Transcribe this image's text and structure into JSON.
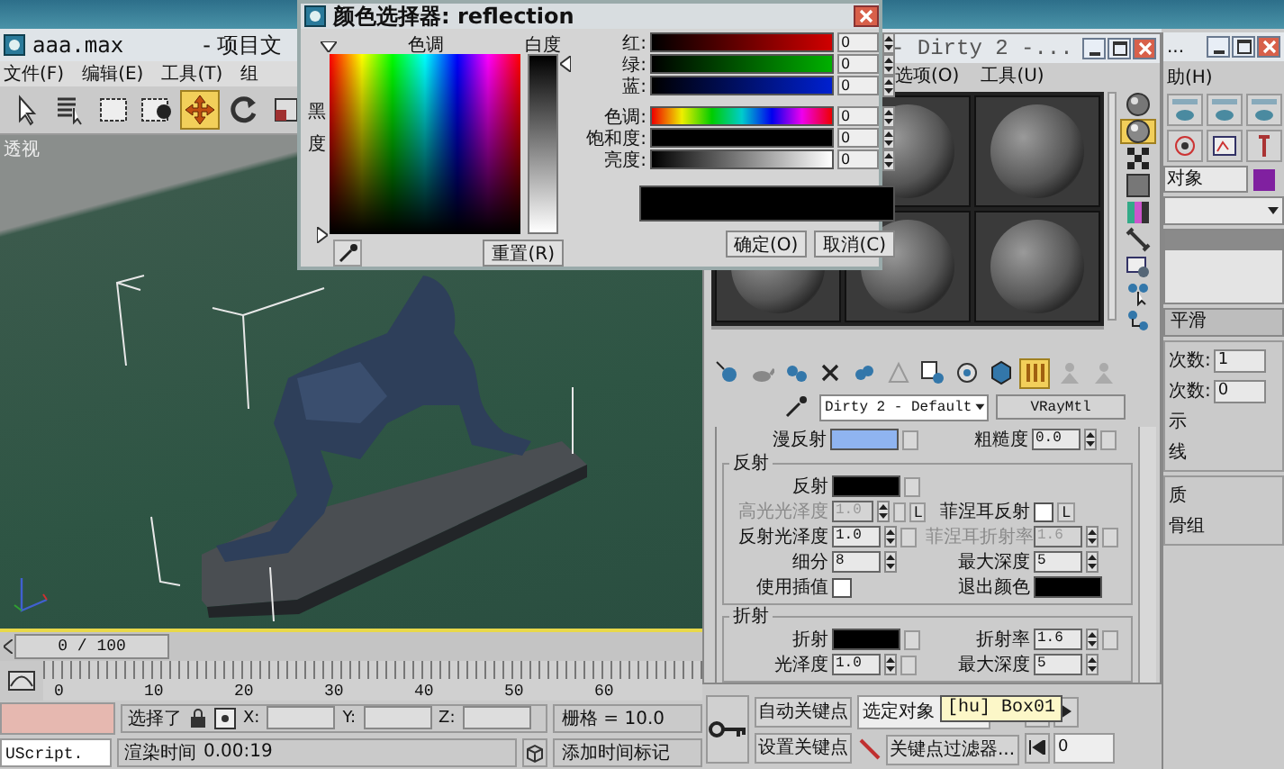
{
  "main_window": {
    "title": "aaa.max",
    "title_tail": "- 项目文",
    "menu": [
      "文件(F)",
      "编辑(E)",
      "工具(T)",
      "组"
    ],
    "toolbar": [
      {
        "selected": false
      },
      {
        "selected": false
      },
      {
        "selected": false
      },
      {
        "selected": false
      },
      {
        "selected": true
      },
      {
        "selected": false
      },
      {
        "selected": false
      }
    ],
    "viewport_label": "透视",
    "time_slider": {
      "label": "0 / 100",
      "level": 0
    },
    "ruler_labels": [
      "0",
      "10",
      "20",
      "30",
      "40",
      "50",
      "60"
    ],
    "status": {
      "script": "UScript.",
      "selection": "选择了",
      "x_label": "X:",
      "y_label": "Y:",
      "z_label": "Z:",
      "grid": "栅格 = 10.0",
      "render_time_label": "渲染时间",
      "render_time": "0.00:19",
      "add_time_tag": "添加时间标记"
    },
    "key_controls": {
      "auto_key": "自动关键点",
      "selected_set": "选定对象",
      "set_key": "设置关键点",
      "key_filters": "关键点过滤器...",
      "frame": "0"
    },
    "tooltip": "[hu] Box01"
  },
  "color_selector": {
    "title": "颜色选择器: reflection",
    "hue_label": "色调",
    "whiteness_label": "白度",
    "blackness_label": "黑度",
    "channels": [
      {
        "label": "红:",
        "value": "0",
        "kind": "red"
      },
      {
        "label": "绿:",
        "value": "0",
        "kind": "green"
      },
      {
        "label": "蓝:",
        "value": "0",
        "kind": "blue"
      },
      {
        "label": "色调:",
        "value": "0",
        "kind": "hue"
      },
      {
        "label": "饱和度:",
        "value": "0",
        "kind": "saturation"
      },
      {
        "label": "亮度:",
        "value": "0",
        "kind": "value"
      }
    ],
    "reset": "重置(R)",
    "ok": "确定(O)",
    "cancel": "取消(C)"
  },
  "material_editor": {
    "title": "- Dirty 2 -...",
    "menu": [
      "选项(O)",
      "工具(U)"
    ],
    "side_tools": [
      {
        "selected": false
      },
      {
        "selected": true
      },
      {
        "selected": false
      },
      {
        "selected": false
      },
      {
        "selected": false
      },
      {
        "selected": false
      },
      {
        "selected": false
      },
      {
        "selected": false
      },
      {
        "selected": false
      }
    ],
    "toolbar": [
      {
        "selected": false
      },
      {
        "selected": false
      },
      {
        "selected": false
      },
      {
        "selected": false
      },
      {
        "selected": false
      },
      {
        "selected": false
      },
      {
        "selected": false
      },
      {
        "selected": false
      },
      {
        "selected": false
      },
      {
        "selected": true
      },
      {
        "selected": false
      },
      {
        "selected": false
      }
    ],
    "material_name": "Dirty 2 - Default",
    "material_type": "VRayMtl",
    "top_row": {
      "left": {
        "kind": "color",
        "label": "漫反射",
        "color": "#8fb4f0",
        "map": true
      },
      "right": {
        "kind": "number",
        "label": "粗糙度",
        "value": "0.0",
        "disabled": false,
        "map": true
      }
    },
    "groups": [
      {
        "title": "反射",
        "rows": [
          {
            "left": {
              "kind": "color",
              "label": "反射",
              "color": "#000000",
              "map": true
            }
          },
          {
            "left": {
              "kind": "number",
              "label": "高光光泽度",
              "value": "1.0",
              "disabled": true,
              "map": true,
              "lock": "L"
            },
            "right": {
              "kind": "check",
              "label": "菲涅耳反射",
              "checked": false,
              "lock": "L"
            }
          },
          {
            "left": {
              "kind": "number",
              "label": "反射光泽度",
              "value": "1.0",
              "disabled": false,
              "map": true
            },
            "right": {
              "kind": "number",
              "label": "菲涅耳折射率",
              "value": "1.6",
              "disabled": true,
              "map": true
            }
          },
          {
            "left": {
              "kind": "number",
              "label": "细分",
              "value": "8",
              "disabled": false,
              "map": false
            },
            "right": {
              "kind": "number",
              "label": "最大深度",
              "value": "5",
              "disabled": false,
              "map": false
            }
          },
          {
            "left": {
              "kind": "check",
              "label": "使用插值",
              "checked": false
            },
            "right": {
              "kind": "color",
              "label": "退出颜色",
              "color": "#000000",
              "map": false
            }
          }
        ]
      },
      {
        "title": "折射",
        "rows": [
          {
            "left": {
              "kind": "color",
              "label": "折射",
              "color": "#000000",
              "map": true
            },
            "right": {
              "kind": "number",
              "label": "折射率",
              "value": "1.6",
              "disabled": false,
              "map": true
            }
          },
          {
            "left": {
              "kind": "number",
              "label": "光泽度",
              "value": "1.0",
              "disabled": false,
              "map": true
            },
            "right": {
              "kind": "number",
              "label": "最大深度",
              "value": "5",
              "disabled": false,
              "map": false
            }
          }
        ]
      }
    ]
  },
  "command_panel": {
    "title": "...",
    "menu": "助(H)",
    "object_field": "对象",
    "rollout": "平滑",
    "spinners": [
      {
        "label": "次数:",
        "value": "1"
      },
      {
        "label": "次数:",
        "value": "0"
      }
    ],
    "labels_a": [
      "示",
      "线"
    ],
    "labels_b": [
      "质",
      "骨组"
    ]
  }
}
